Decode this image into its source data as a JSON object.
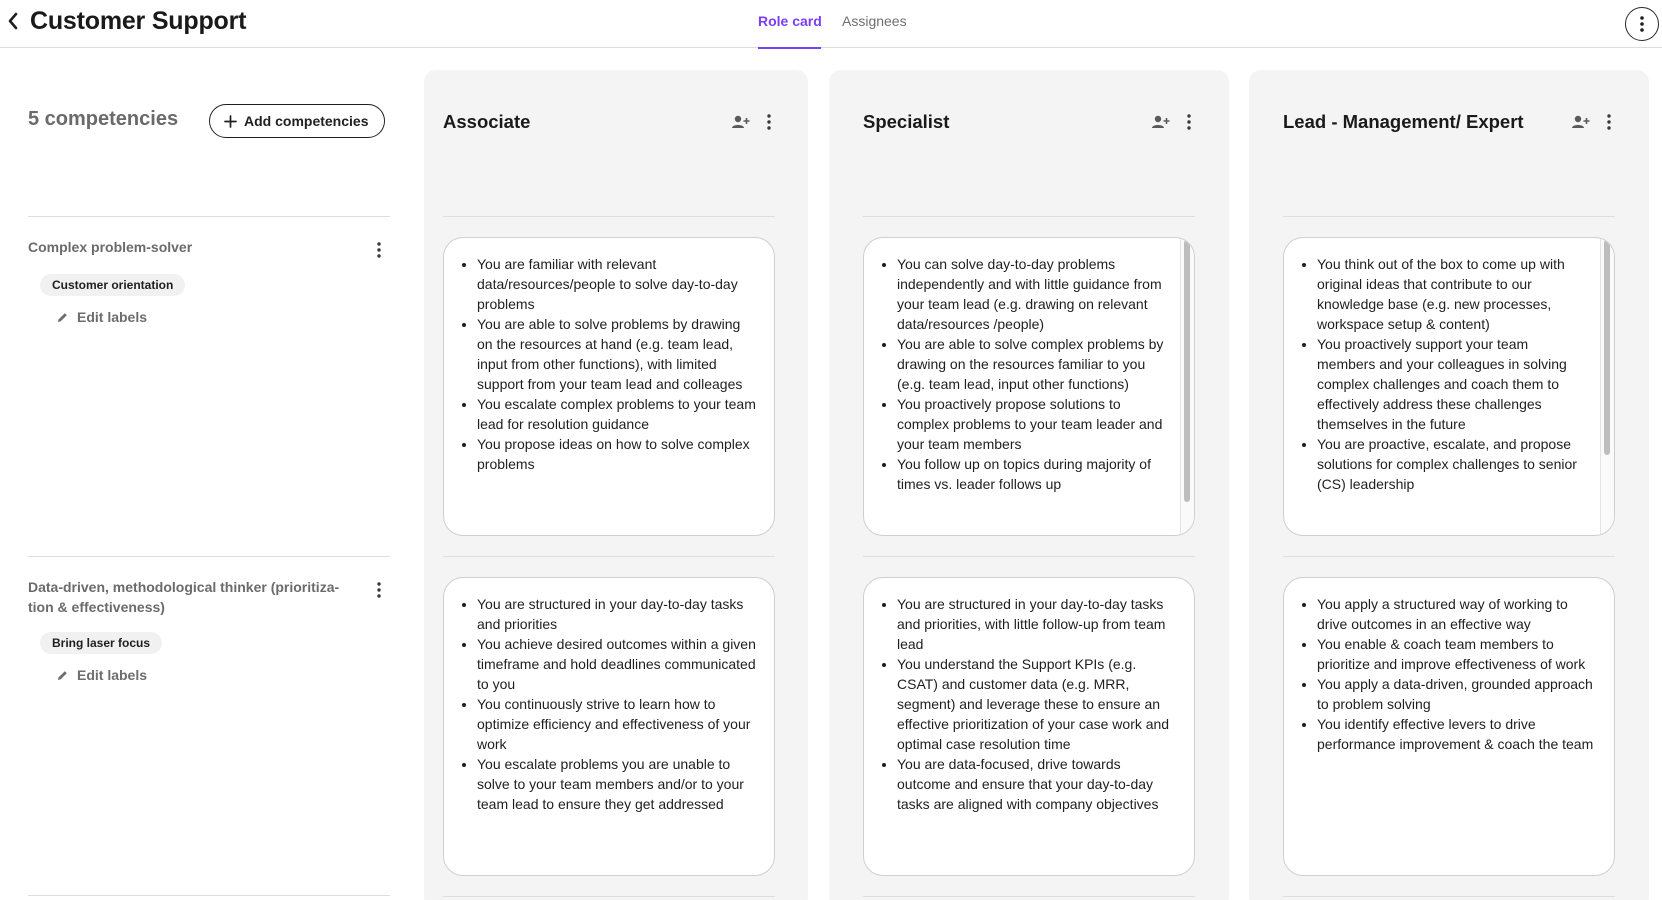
{
  "header": {
    "title": "Customer Support",
    "tabs": [
      {
        "label": "Role card",
        "active": true
      },
      {
        "label": "Assignees",
        "active": false
      }
    ]
  },
  "competencies": {
    "count_label": "5 competencies",
    "add_label": "Add competencies",
    "items": [
      {
        "name": "Complex problem-solver",
        "label": "Customer orientation",
        "edit_label": "Edit labels"
      },
      {
        "name": "Data-driven, methodological thinker (prioritiza-tion & effectiveness)",
        "label": "Bring laser focus",
        "edit_label": "Edit labels"
      }
    ]
  },
  "levels": [
    {
      "title": "Associate"
    },
    {
      "title": "Specialist"
    },
    {
      "title": "Lead - Management/ Expert"
    }
  ],
  "cells": [
    [
      [
        "You are familiar with relevant data/resources/people to solve day-to-day problems",
        "You are able to solve problems by drawing on the resources at hand (e.g. team lead, input from other functions), with limited support from your team lead and colleages",
        "You escalate complex problems to your team lead for resolution guidance",
        "You propose ideas on how to solve complex problems"
      ],
      [
        "You can solve day-to-day problems independently and with little guidance from your team lead (e.g. drawing on relevant data/resources /people)",
        "You are able to solve complex problems by drawing on the resources familiar to you (e.g. team lead, input other functions)",
        "You proactively propose solutions to complex problems to your team leader and your team members",
        "You follow up on topics during majority of times vs. leader follows up"
      ],
      [
        "You think out of the box to come up with original ideas that contribute to our knowledge base (e.g. new processes, workspace setup & content)",
        "You proactively support your team members and your colleagues in solving complex challenges and coach them to effectively address these challenges themselves in the future",
        "You are proactive, escalate, and propose solutions for complex challenges to senior (CS) leadership"
      ]
    ],
    [
      [
        "You are structured in your day-to-day tasks and priorities",
        "You achieve desired outcomes within a given timeframe and hold deadlines communicated to you",
        "You continuously strive to learn how to optimize efficiency and effectiveness of your work",
        "You escalate problems you are unable to solve to your team members and/or to your team lead to ensure they get addressed"
      ],
      [
        "You are structured in your day-to-day tasks and priorities, with little follow-up from team lead",
        "You understand the Support KPIs (e.g. CSAT) and customer data (e.g. MRR, segment) and leverage these to ensure an effective prioritization of your case work and optimal case resolution time",
        "You are data-focused, drive towards outcome and ensure that your day-to-day tasks are aligned with company objectives"
      ],
      [
        "You apply a structured way of working to drive outcomes in an effective way",
        "You enable & coach team members to prioritize and improve effectiveness of work",
        "You apply a data-driven, grounded approach to problem solving",
        "You identify effective levers to drive performance improvement & coach the team"
      ]
    ]
  ],
  "colors": {
    "accent": "#7a3ff2",
    "column_bg": "#f4f4f4"
  }
}
